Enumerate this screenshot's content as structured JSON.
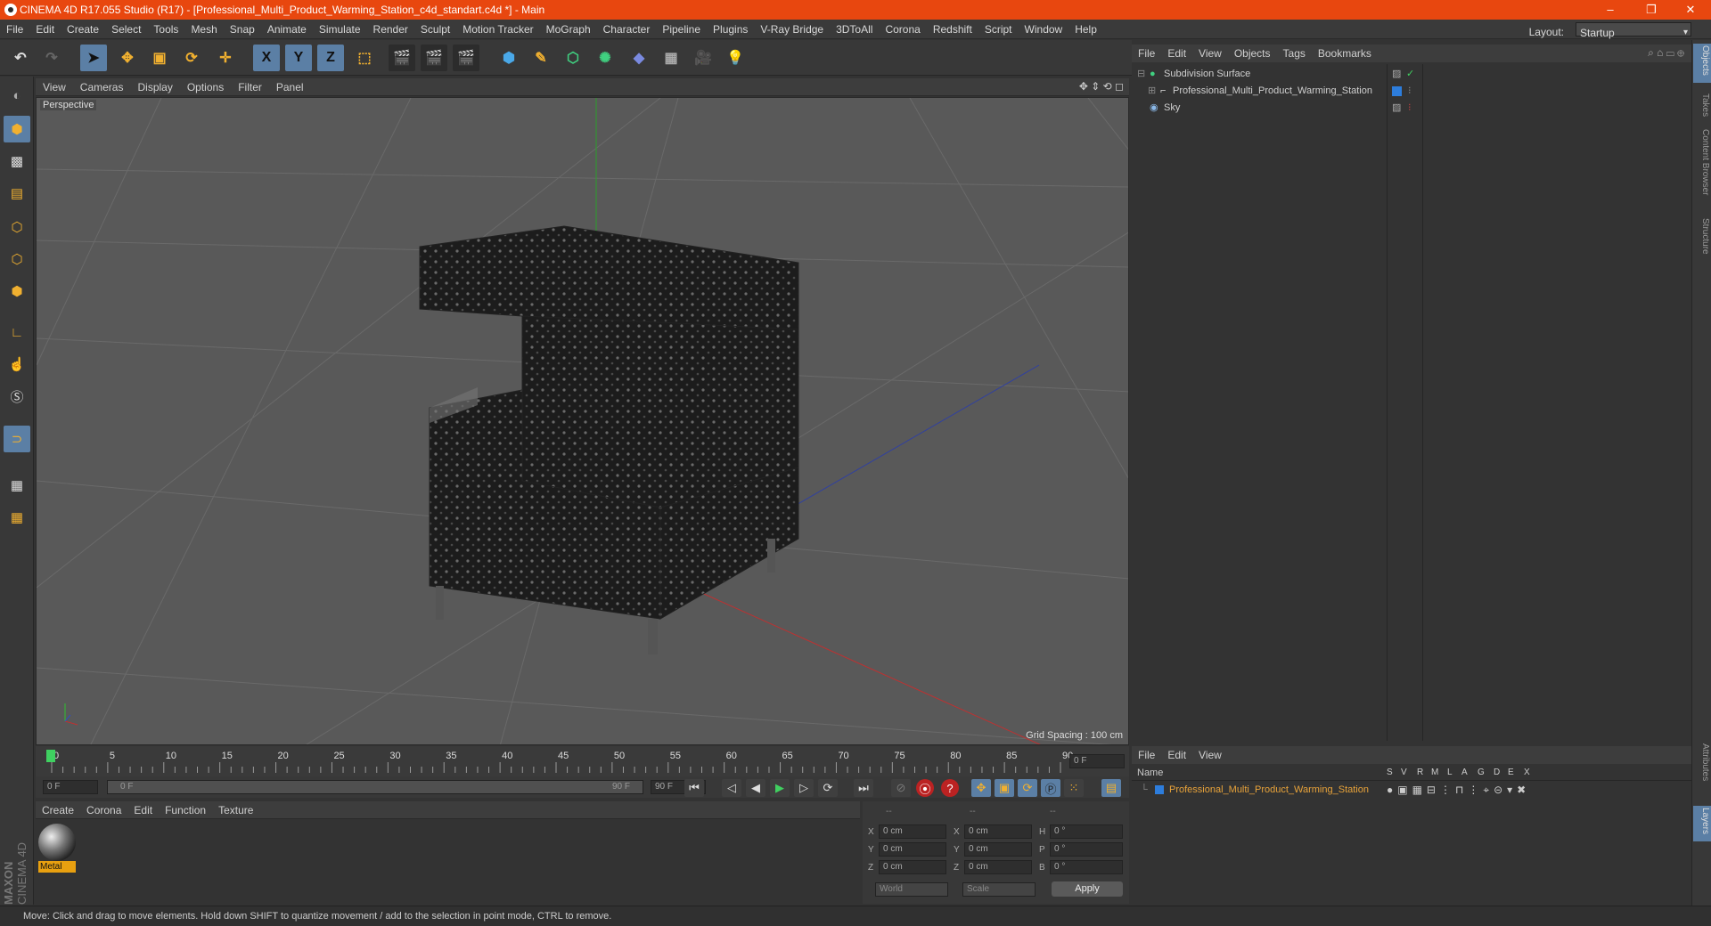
{
  "window": {
    "title": "CINEMA 4D R17.055 Studio (R17) - [Professional_Multi_Product_Warming_Station_c4d_standart.c4d *] - Main",
    "minimize": "–",
    "restore": "❐",
    "close": "✕"
  },
  "menubar": {
    "items": [
      "File",
      "Edit",
      "Create",
      "Select",
      "Tools",
      "Mesh",
      "Snap",
      "Animate",
      "Simulate",
      "Render",
      "Sculpt",
      "Motion Tracker",
      "MoGraph",
      "Character",
      "Pipeline",
      "Plugins",
      "V-Ray Bridge",
      "3DToAll",
      "Corona",
      "Redshift",
      "Script",
      "Window",
      "Help"
    ],
    "layout_label": "Layout:",
    "layout_value": "Startup"
  },
  "toolbar": {
    "axis_x": "X",
    "axis_y": "Y",
    "axis_z": "Z"
  },
  "viewport": {
    "menu": [
      "View",
      "Cameras",
      "Display",
      "Options",
      "Filter",
      "Panel"
    ],
    "label": "Perspective",
    "grid_spacing": "Grid Spacing : 100 cm"
  },
  "timeline": {
    "ticks": [
      "0",
      "5",
      "10",
      "15",
      "20",
      "25",
      "30",
      "35",
      "40",
      "45",
      "50",
      "55",
      "60",
      "65",
      "70",
      "75",
      "80",
      "85",
      "90"
    ],
    "current_frame": "0 F",
    "start_field": "0 F",
    "range_start": "0 F",
    "range_end": "90 F",
    "end_field": "90 F"
  },
  "materials": {
    "menu": [
      "Create",
      "Corona",
      "Edit",
      "Function",
      "Texture"
    ],
    "items": [
      {
        "name": "Metal"
      }
    ]
  },
  "coordinates": {
    "headers": [
      "--",
      "--",
      "--"
    ],
    "rows": [
      {
        "a": "X",
        "av": "0 cm",
        "b": "X",
        "bv": "0 cm",
        "c": "H",
        "cv": "0 °"
      },
      {
        "a": "Y",
        "av": "0 cm",
        "b": "Y",
        "bv": "0 cm",
        "c": "P",
        "cv": "0 °"
      },
      {
        "a": "Z",
        "av": "0 cm",
        "b": "Z",
        "bv": "0 cm",
        "c": "B",
        "cv": "0 °"
      }
    ],
    "mode1": "World",
    "mode2": "Scale",
    "apply": "Apply"
  },
  "objects": {
    "menu": [
      "File",
      "Edit",
      "View",
      "Objects",
      "Tags",
      "Bookmarks"
    ],
    "items": [
      {
        "name": "Subdivision Surface"
      },
      {
        "name": "Professional_Multi_Product_Warming_Station"
      },
      {
        "name": "Sky"
      }
    ]
  },
  "layers": {
    "menu": [
      "File",
      "Edit",
      "View"
    ],
    "col_name": "Name",
    "cols": [
      "S",
      "V",
      "R",
      "M",
      "L",
      "A",
      "G",
      "D",
      "E",
      "X"
    ],
    "items": [
      {
        "name": "Professional_Multi_Product_Warming_Station"
      }
    ]
  },
  "right_tabs": [
    "Objects",
    "Takes",
    "Content Browser",
    "Structure",
    "Attributes",
    "Layers"
  ],
  "brand": {
    "maxon": "MAXON",
    "product": "CINEMA 4D"
  },
  "status": "Move: Click and drag to move elements. Hold down SHIFT to quantize movement / add to the selection in point mode, CTRL to remove.",
  "colors": {
    "titlebar": "#e8470f",
    "accent": "#5b7fa5",
    "layer_text": "#e8a33a",
    "layer_color": "#2d7ddc"
  }
}
